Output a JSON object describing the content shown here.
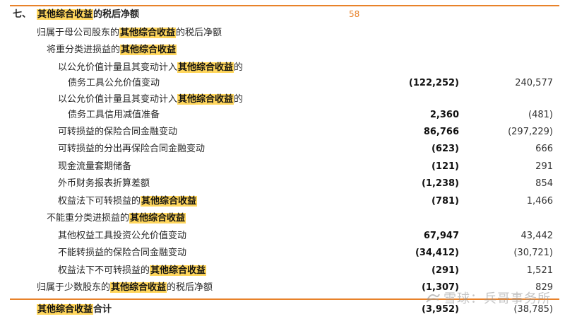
{
  "header": {
    "section_number": "七、",
    "title_highlight": "其他综合收益",
    "title_rest": "的税后净额",
    "note_ref": "58"
  },
  "rows": [
    {
      "pre": "归属于母公司股东的",
      "hl": "其他综合收益",
      "post": "的税后净额",
      "cur": "",
      "prev": ""
    },
    {
      "pre": "将重分类进损益的",
      "hl": "其他综合收益",
      "post": "",
      "cur": "",
      "prev": ""
    },
    {
      "pre": "以公允价值计量且其变动计入",
      "hl": "其他综合收益",
      "post": "的",
      "cur": "",
      "prev": ""
    },
    {
      "pre": "债务工具公允价值变动",
      "hl": "",
      "post": "",
      "cur": "(122,252)",
      "prev": "240,577"
    },
    {
      "pre": "以公允价值计量且其变动计入",
      "hl": "其他综合收益",
      "post": "的",
      "cur": "",
      "prev": ""
    },
    {
      "pre": "债务工具信用减值准备",
      "hl": "",
      "post": "",
      "cur": "2,360",
      "prev": "(481)"
    },
    {
      "pre": "可转损益的保险合同金融变动",
      "hl": "",
      "post": "",
      "cur": "86,766",
      "prev": "(297,229)"
    },
    {
      "pre": "可转损益的分出再保险合同金融变动",
      "hl": "",
      "post": "",
      "cur": "(623)",
      "prev": "666"
    },
    {
      "pre": "现金流量套期储备",
      "hl": "",
      "post": "",
      "cur": "(121)",
      "prev": "291"
    },
    {
      "pre": "外币财务报表折算差额",
      "hl": "",
      "post": "",
      "cur": "(1,238)",
      "prev": "854"
    },
    {
      "pre": "权益法下可转损益的",
      "hl": "其他综合收益",
      "post": "",
      "cur": "(781)",
      "prev": "1,466"
    },
    {
      "pre": "不能重分类进损益的",
      "hl": "其他综合收益",
      "post": "",
      "cur": "",
      "prev": ""
    },
    {
      "pre": "其他权益工具投资公允价值变动",
      "hl": "",
      "post": "",
      "cur": "67,947",
      "prev": "43,442"
    },
    {
      "pre": "不能转损益的保险合同金融变动",
      "hl": "",
      "post": "",
      "cur": "(34,412)",
      "prev": "(30,721)"
    },
    {
      "pre": "权益法下不可转损益的",
      "hl": "其他综合收益",
      "post": "",
      "cur": "(291)",
      "prev": "1,521"
    },
    {
      "pre": "归属于少数股东的",
      "hl": "其他综合收益",
      "post": "的税后净额",
      "cur": "(1,307)",
      "prev": "829"
    }
  ],
  "total": {
    "hl": "其他综合收益",
    "rest": "合计",
    "cur": "(3,952)",
    "prev": "(38,785)"
  },
  "watermark": "雪球：兵哥事务所"
}
